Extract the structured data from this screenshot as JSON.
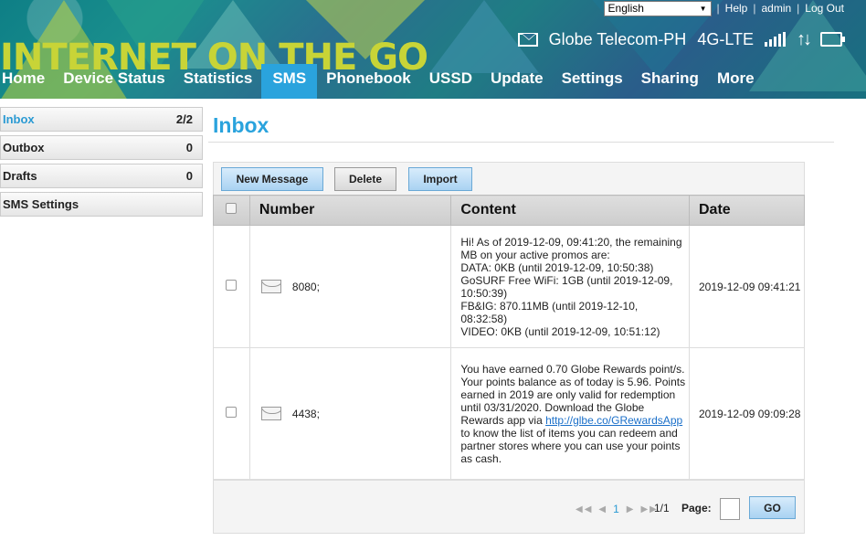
{
  "header": {
    "brand": "INTERNET ON THE GO",
    "language": "English",
    "links": [
      "Help",
      "admin",
      "Log Out"
    ],
    "operator": "Globe Telecom-PH",
    "network": "4G-LTE",
    "icons": [
      "envelope-icon",
      "signal-icon",
      "updown-arrows-icon",
      "wifi-monitor-icon"
    ]
  },
  "nav": {
    "tabs": [
      {
        "label": "Home"
      },
      {
        "label": "Device Status"
      },
      {
        "label": "Statistics"
      },
      {
        "label": "SMS"
      },
      {
        "label": "Phonebook"
      },
      {
        "label": "USSD"
      },
      {
        "label": "Update"
      },
      {
        "label": "Settings"
      },
      {
        "label": "Sharing"
      },
      {
        "label": "More"
      }
    ],
    "active": "SMS"
  },
  "sidebar": {
    "items": [
      {
        "label": "Inbox",
        "count": "2/2"
      },
      {
        "label": "Outbox",
        "count": "0"
      },
      {
        "label": "Drafts",
        "count": "0"
      },
      {
        "label": "SMS Settings",
        "count": ""
      }
    ]
  },
  "main": {
    "title": "Inbox",
    "toolbar": {
      "new_message": "New Message",
      "delete": "Delete",
      "import": "Import"
    },
    "table": {
      "headers": [
        "Number",
        "Content",
        "Date"
      ],
      "rows": [
        {
          "number": "8080;",
          "content_lines": [
            "Hi! As of 2019-12-09, 09:41:20, the remaining",
            "MB on your active promos are:",
            "DATA: 0KB (until 2019-12-09, 10:50:38)",
            "GoSURF Free WiFi: 1GB (until 2019-12-09,",
            "10:50:39)",
            "FB&IG: 870.11MB (until 2019-12-10, 08:32:58)",
            "VIDEO: 0KB (until 2019-12-09, 10:51:12)"
          ],
          "date": "2019-12-09 09:41:21"
        },
        {
          "number": "4438;",
          "content_lines": [
            "You have earned 0.70 Globe Rewards point/s.",
            "Your points balance as of today is 5.96. Points",
            "earned in 2019 are only valid for redemption",
            "until 03/31/2020. Download the Globe",
            "Rewards app via ",
            "to know the list of items you can redeem and",
            "partner stores where you can use your points",
            "as cash."
          ],
          "link": "http://glbe.co/GRewardsApp",
          "date": "2019-12-09 09:09:28"
        }
      ]
    },
    "pager": {
      "current": "1",
      "total": "1/1",
      "page_label": "Page:",
      "page_input": "",
      "go": "GO"
    }
  },
  "colors": {
    "accent": "#2aa3dd",
    "brand_text": "#c8d437",
    "link": "#1a6fc9"
  }
}
